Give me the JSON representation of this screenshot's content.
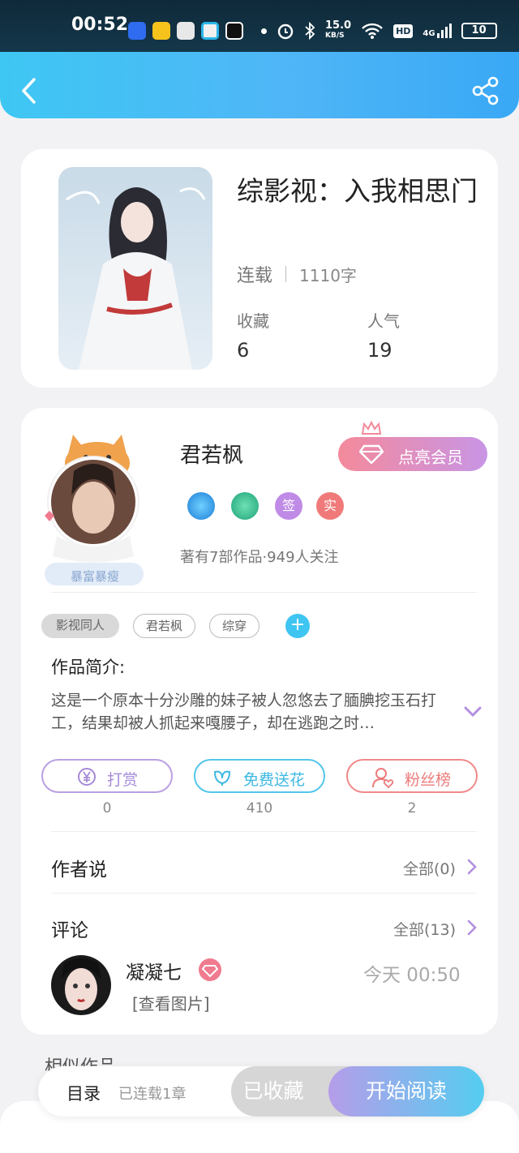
{
  "status_bar": {
    "time": "00:52",
    "net_speed": "15.0",
    "net_unit": "KB/S",
    "hd": "HD",
    "signal": "4G",
    "battery": "10"
  },
  "colors": {
    "accent_blue": "#3ec7f3",
    "vip_pink": "#f48a9b",
    "vip_purple": "#c895e6",
    "reward_purple": "#b9a0e3",
    "flower_cyan": "#52c6ea",
    "fan_red": "#f08a8a"
  },
  "book": {
    "title": "综影视：入我相思门",
    "status": "连载",
    "word_count": "1110字",
    "favorites_label": "收藏",
    "favorites_value": "6",
    "popularity_label": "人气",
    "popularity_value": "19"
  },
  "author": {
    "name": "君若枫",
    "vip_button": "点亮会员",
    "badge_sign": "签",
    "badge_real": "实",
    "info": "著有7部作品·949人关注",
    "avatar_tag": "暴富暴瘦"
  },
  "tags": [
    "影视同人",
    "君若枫",
    "综穿"
  ],
  "intro": {
    "title": "作品简介:",
    "text": "这是一个原本十分沙雕的妹子被人忽悠去了腼腆挖玉石打工，结果却被人抓起来嘎腰子，却在逃跑之时…"
  },
  "actions": {
    "reward_label": "打赏",
    "reward_count": "0",
    "flower_label": "免费送花",
    "flower_count": "410",
    "fans_label": "粉丝榜",
    "fans_count": "2"
  },
  "author_says": {
    "title": "作者说",
    "more": "全部(0)"
  },
  "comments": {
    "title": "评论",
    "more": "全部(13)",
    "items": [
      {
        "user": "凝凝七",
        "time": "今天 00:50",
        "text": "[查看图片]"
      }
    ]
  },
  "similar": {
    "title": "相似作品"
  },
  "bottom_bar": {
    "toc": "目录",
    "update_status": "已连载1章",
    "favorited": "已收藏",
    "start_reading": "开始阅读"
  },
  "icons": [
    "back-arrow-icon",
    "share-icon",
    "diamond-icon",
    "crown-icon",
    "yuan-icon",
    "flower-icon",
    "person-heart-icon",
    "chevron-right-icon",
    "chevron-down-icon",
    "plus-icon"
  ]
}
